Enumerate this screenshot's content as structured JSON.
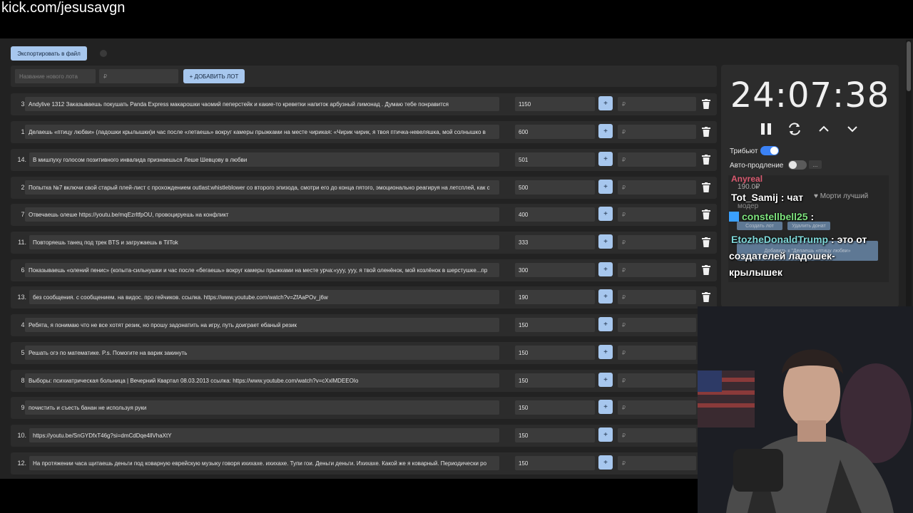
{
  "url": "kick.com/jesusavgn",
  "toolbar": {
    "export_label": "Экспортировать в файл"
  },
  "new_lot": {
    "name_placeholder": "Название нового лота",
    "amount_placeholder": "₽",
    "add_label": "+ ДОБАВИТЬ ЛОТ"
  },
  "lots": [
    {
      "num": "3.",
      "name": "Andylive 1312 Заказываешь покушать Panda Express макарошки чаомий пеперстейк и какие-то креветки напиток арбузный лимонад . Думаю тебе понравится",
      "amount": "1150"
    },
    {
      "num": "1.",
      "name": "Делаешь «птицу любви» (ладошки крылышки)и час после «летаешь» вокруг камеры прыжками на месте чирикая: «Чирик чирик, я твоя птичка-невеляшка, мой солнышко в",
      "amount": "600"
    },
    {
      "num": "14.",
      "name": "В мишпуху голосом позитивного инвалида признаешься Леше Шевцову в любви",
      "amount": "501"
    },
    {
      "num": "2.",
      "name": "Попытка №7 включи свой старый плей-лист с прохождением outlast:whistleblower со второго эпизода, смотри его до конца пятого, эмоционально реагируя на летсплей, как с",
      "amount": "500"
    },
    {
      "num": "7.",
      "name": "Отвечаешь олеше https://youtu.be/mqEzrltfpOU, провоцируешь на конфликт",
      "amount": "400"
    },
    {
      "num": "11.",
      "name": "Повторяешь танец под трек BTS и загружаешь в TilTok",
      "amount": "333"
    },
    {
      "num": "6.",
      "name": "Показываешь «олений пенис» (копыта-сильнушки и час после «бегаешь» вокруг камеры прыжками на месте урча:«ууу, ууу, я твой оленёнок, мой козлёнок в шерстушке...пр",
      "amount": "300"
    },
    {
      "num": "13.",
      "name": "без сообщения. с сообщением. на видос. про гейчиков. ссылка. https://www.youtube.com/watch?v=ZfAaPOv_j6w",
      "amount": "190"
    },
    {
      "num": "4.",
      "name": "Ребята, я понимаю что не все хотят резик, но прошу задонатить на игру, путь доиграет ебаный резик",
      "amount": "150"
    },
    {
      "num": "5.",
      "name": "Решать огэ по математике. P.s. Помогите на варик закинуть",
      "amount": "150"
    },
    {
      "num": "8.",
      "name": "Выборы: психиатрическая больница | Вечерний Квартал 08.03.2013 ссылка: https://www.youtube.com/watch?v=cXxlMDEEOIo",
      "amount": "150"
    },
    {
      "num": "9.",
      "name": "почистить и съесть банан не используя руки",
      "amount": "150"
    },
    {
      "num": "10.",
      "name": "https://youtu.be/SnGYDfxT46g?si=dmCdDqe4llVhaXtY",
      "amount": "150"
    },
    {
      "num": "12.",
      "name": "На протяжении часа щитаешь деньги под коварную еврейскую музыку говоря ихихахе. ихихахе. Тупи гои. Деньги деньги. Ихихахе. Какой же я коварный. Периодически ро",
      "amount": "150"
    }
  ],
  "rub_placeholder": "₽",
  "timer": {
    "value": "24:07:38",
    "tribute_label": "Трибьют",
    "auto_extend_label": "Авто-продление",
    "more_label": "..."
  },
  "chat_faded": {
    "name": "Anyreal",
    "amount": "190.0₽",
    "role": "модер",
    "heart_text": "♥ Морти лучший",
    "btn_create": "Создать лот",
    "btn_delete": "Удалить донат",
    "btn_add": "Добавить к \"Делаешь «птицу любви»"
  },
  "chat": [
    {
      "user": "Tot_Samij",
      "text": "чат",
      "user_color": "#ffffff"
    },
    {
      "user": "constellbell25",
      "text": "",
      "user_color": "#7ee37e"
    },
    {
      "user": "EtozheDonaldTrump",
      "text": "это от создателей ладошек-крылышек",
      "user_color": "#7fd8d8"
    }
  ],
  "colors": {
    "accent": "#a7c7ee",
    "toggle_on": "#3b82f6",
    "panel": "#2c2c2c"
  }
}
